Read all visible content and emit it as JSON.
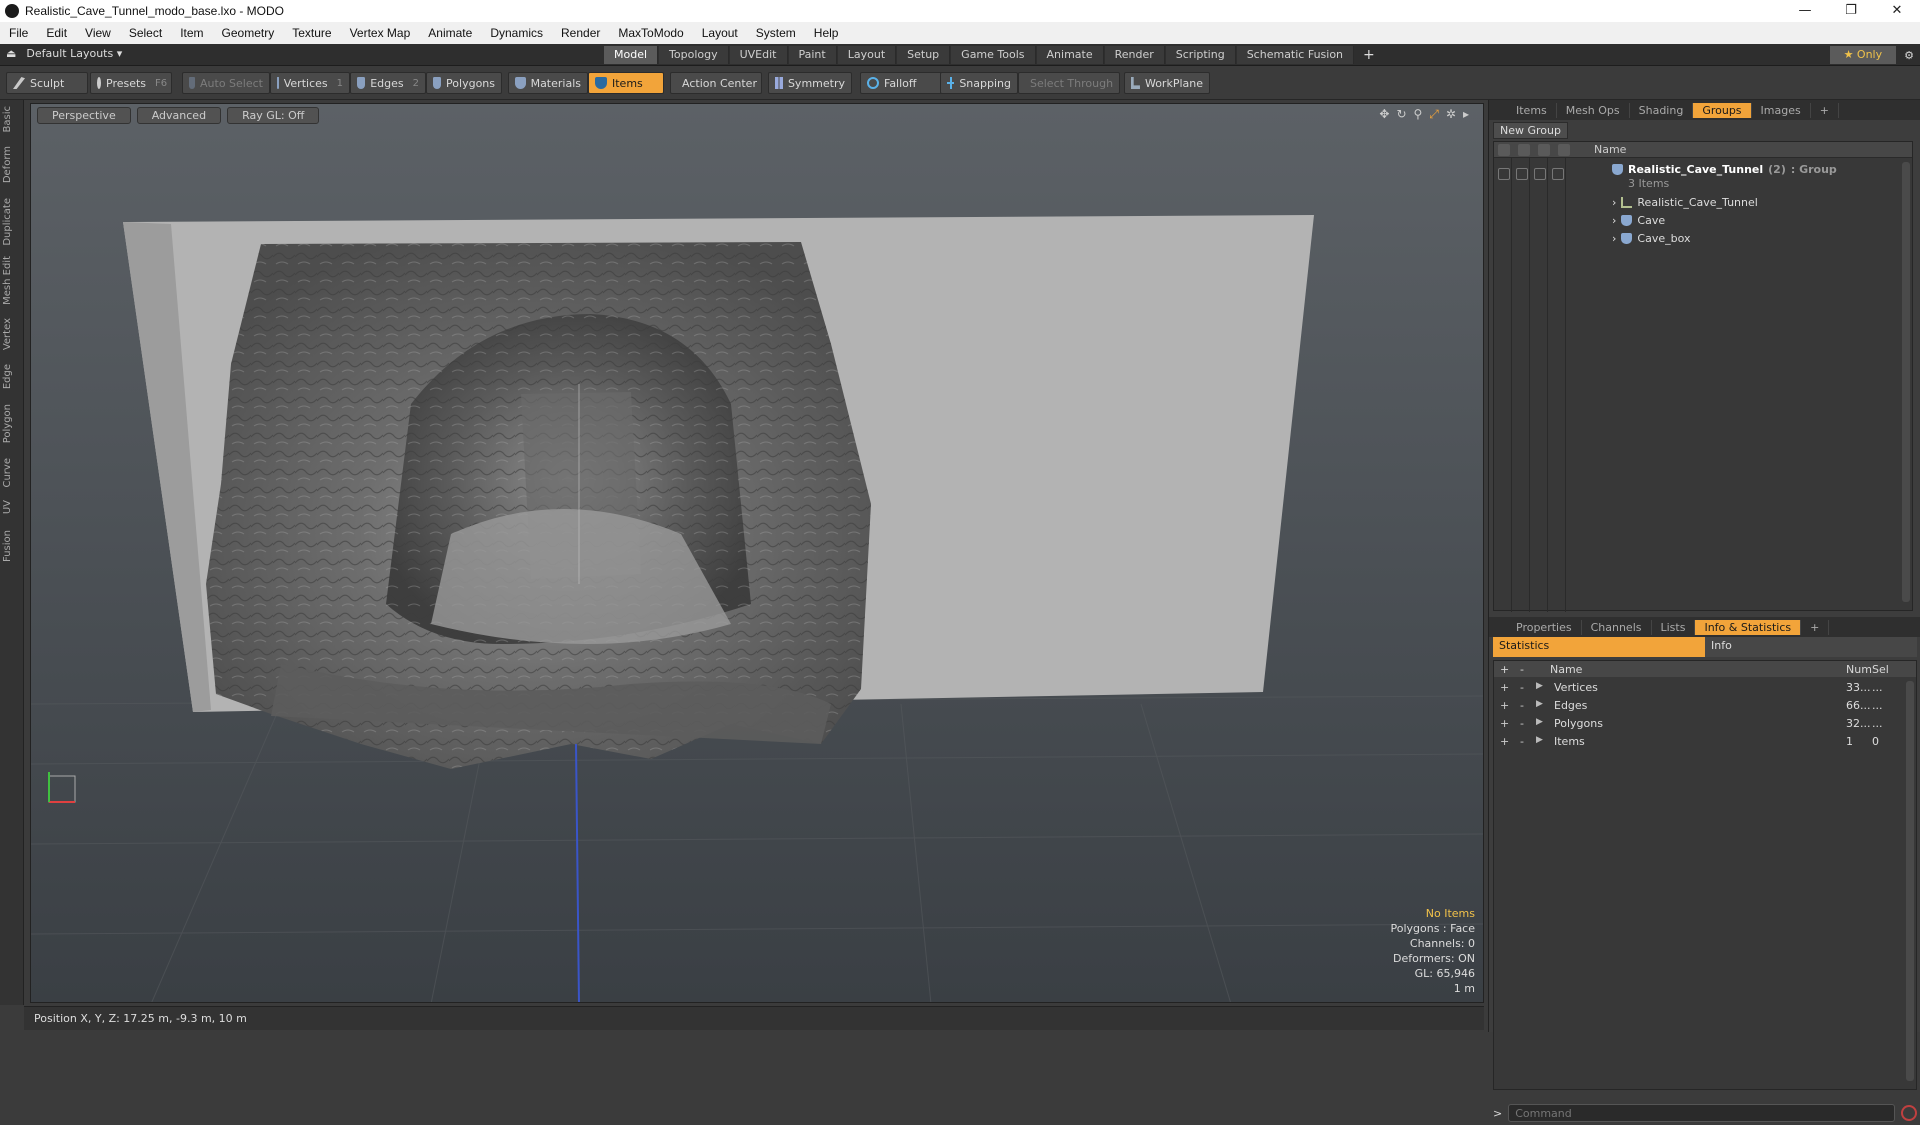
{
  "window": {
    "title": "Realistic_Cave_Tunnel_modo_base.lxo - MODO",
    "minimize": "—",
    "maximize": "❐",
    "close": "✕"
  },
  "menu": [
    "File",
    "Edit",
    "View",
    "Select",
    "Item",
    "Geometry",
    "Texture",
    "Vertex Map",
    "Animate",
    "Dynamics",
    "Render",
    "MaxToModo",
    "Layout",
    "System",
    "Help"
  ],
  "layout_tabs": {
    "layouts_label": "Default Layouts",
    "tabs": [
      "Model",
      "Topology",
      "UVEdit",
      "Paint",
      "Layout",
      "Setup",
      "Game Tools",
      "Animate",
      "Render",
      "Scripting",
      "Schematic Fusion"
    ],
    "active": "Model",
    "only_label": "Only"
  },
  "toolbar": {
    "sculpt": "Sculpt",
    "presets": "Presets",
    "presets_key": "F6",
    "auto_select": "Auto Select",
    "vertices": "Vertices",
    "vertices_count": "1",
    "edges": "Edges",
    "edges_count": "2",
    "polygons": "Polygons",
    "materials": "Materials",
    "items": "Items",
    "action_center": "Action Center",
    "symmetry": "Symmetry",
    "falloff": "Falloff",
    "snapping": "Snapping",
    "select_through": "Select Through",
    "workplane": "WorkPlane"
  },
  "left_tabs": [
    "Basic",
    "Deform",
    "Duplicate",
    "Mesh Edit",
    "Vertex",
    "Edge",
    "Polygon",
    "Curve",
    "UV",
    "Fusion"
  ],
  "viewport": {
    "perspective": "Perspective",
    "advanced": "Advanced",
    "raygl": "Ray GL: Off",
    "stats": {
      "no_items": "No Items",
      "polygons": "Polygons : Face",
      "channels": "Channels: 0",
      "deformers": "Deformers: ON",
      "gl": "GL: 65,946",
      "scale": "1 m"
    }
  },
  "status": {
    "position": "Position X, Y, Z:  17.25 m, -9.3 m, 10 m"
  },
  "groups_panel": {
    "tabs": [
      "Items",
      "Mesh Ops",
      "Shading",
      "Groups",
      "Images"
    ],
    "active": "Groups",
    "new_group": "New Group",
    "header_name": "Name",
    "group": {
      "name": "Realistic_Cave_Tunnel",
      "count": "(2)",
      "type": ": Group",
      "items": "3 Items"
    },
    "children": [
      "Realistic_Cave_Tunnel",
      "Cave",
      "Cave_box"
    ]
  },
  "stats_panel": {
    "tabs": [
      "Properties",
      "Channels",
      "Lists",
      "Info & Statistics"
    ],
    "active": "Info & Statistics",
    "subtabs": [
      "Statistics",
      "Info"
    ],
    "columns": {
      "name": "Name",
      "num": "Num",
      "sel": "Sel"
    },
    "rows": [
      {
        "name": "Vertices",
        "num": "33...",
        "sel": "..."
      },
      {
        "name": "Edges",
        "num": "66...",
        "sel": "..."
      },
      {
        "name": "Polygons",
        "num": "32...",
        "sel": "..."
      },
      {
        "name": "Items",
        "num": "1",
        "sel": "0"
      }
    ]
  },
  "command": {
    "placeholder": "Command",
    "prompt": ">"
  }
}
